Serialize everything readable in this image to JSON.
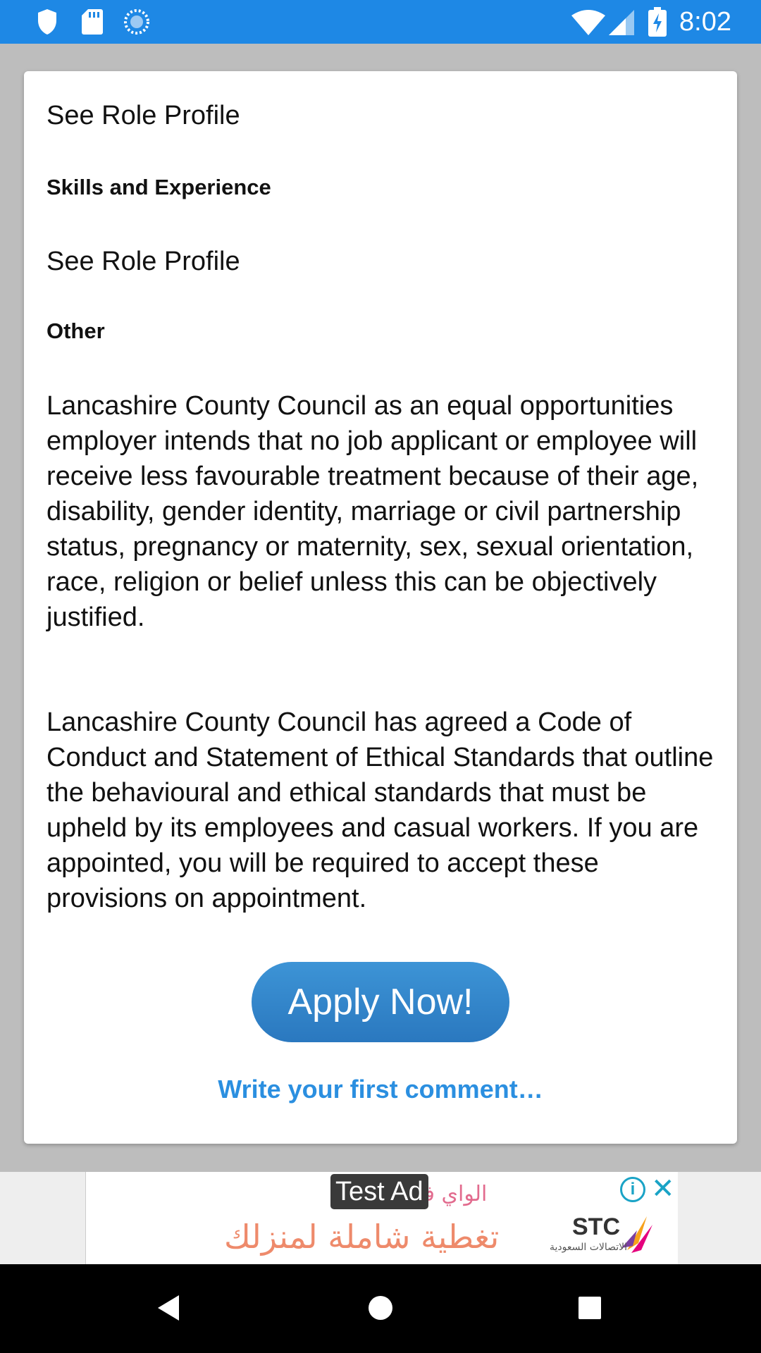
{
  "status_bar": {
    "time": "8:02",
    "icons": [
      "shield-icon",
      "sd-card-icon",
      "sync-icon",
      "wifi-icon",
      "signal-icon",
      "battery-charging-icon"
    ]
  },
  "card": {
    "sections": {
      "role_profile_1": "See Role Profile",
      "skills_heading": "Skills and Experience",
      "role_profile_2": "See Role Profile",
      "other_heading": "Other"
    },
    "paragraphs": [
      "Lancashire County Council as an equal opportunities employer intends that no job applicant or employee will receive less favourable treatment because of their age, disability, gender identity, marriage or civil partnership status, pregnancy or maternity, sex, sexual orientation, race, religion or belief unless this can be objectively justified.",
      "Lancashire County Council has agreed a Code of Conduct and Statement of Ethical Standards that outline the behavioural and ethical standards that must be upheld by its employees and casual workers. If you are appointed, you will be required to accept these provisions on appointment."
    ],
    "apply_label": "Apply Now!",
    "comment_label": "Write your first comment…"
  },
  "ad": {
    "label": "Test Ad",
    "line1": "الواي فاي",
    "line2": "تغطية شاملة لمنزلك",
    "brand": "STC",
    "brand_sub": "الاتصالات السعودية",
    "info_icon": "info-icon",
    "close_icon": "close-icon"
  },
  "nav_bar": {
    "icons": [
      "back-icon",
      "home-icon",
      "recents-icon"
    ]
  },
  "colors": {
    "status_bar": "#1e88e5",
    "accent": "#2b8fe0",
    "button": "#2f80c6"
  }
}
